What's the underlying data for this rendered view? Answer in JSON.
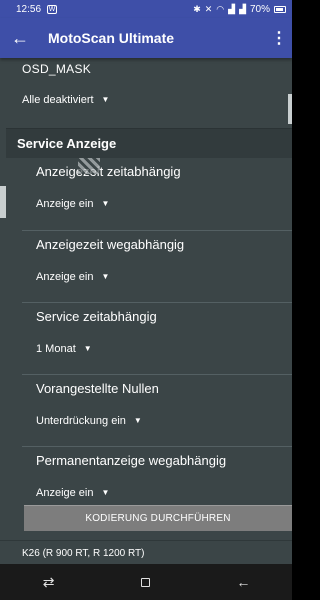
{
  "status_bar": {
    "time": "12:56",
    "notification_icon": "W",
    "battery": "70%",
    "icons": [
      "bluetooth-icon",
      "mute-icon",
      "wifi-icon",
      "signal-icon",
      "signal-icon",
      "battery-icon"
    ]
  },
  "app_bar": {
    "back_icon": "←",
    "title": "MotoScan Ultimate",
    "menu_icon": "⋮"
  },
  "osd": {
    "label": "OSD_MASK",
    "value": "Alle deaktiviert"
  },
  "section": {
    "title": "Service Anzeige"
  },
  "settings": [
    {
      "title": "Anzeigezeit zeitabhängig",
      "value": "Anzeige ein"
    },
    {
      "title": "Anzeigezeit wegabhängig",
      "value": "Anzeige ein"
    },
    {
      "title": "Service zeitabhängig",
      "value": "1 Monat"
    },
    {
      "title": "Vorangestellte Nullen",
      "value": "Unterdrückung ein"
    },
    {
      "title": "Permanentanzeige wegabhängig",
      "value": "Anzeige ein"
    }
  ],
  "action_button": {
    "label": "KODIERUNG DURCHFÜHREN"
  },
  "footer": {
    "vehicle": "K26 (R 900 RT, R 1200 RT)"
  },
  "nav_bar": {
    "recent": "⇄",
    "back": "←"
  },
  "colors": {
    "app_bar": "#3e4fa8",
    "background": "#3b4547",
    "button": "#7d7d7d"
  }
}
